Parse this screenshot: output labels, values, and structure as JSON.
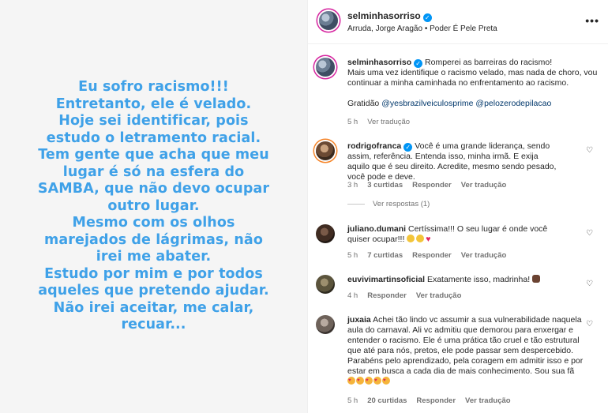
{
  "story": {
    "lines": [
      "Eu sofro racismo!!!",
      "Entretanto, ele é  velado.",
      "Hoje sei identificar, pois",
      "estudo o letramento  racial.",
      "Tem gente que acha que meu",
      "lugar é só  na esfera  do",
      "SAMBA,  que não  devo ocupar",
      "outro lugar.",
      "Mesmo com os olhos",
      "marejados de lágrimas, não",
      "irei me abater.",
      "Estudo por mim e por todos",
      "aqueles que pretendo ajudar.",
      "Não  irei aceitar, me calar,",
      "recuar..."
    ],
    "text_color": "#3fa1e8"
  },
  "header": {
    "username": "selminhasorriso",
    "subtitle": "Arruda, Jorge Aragão • Poder É Pele Preta",
    "more_icon": "•••"
  },
  "caption": {
    "username": "selminhasorriso",
    "line1": "Romperei as barreiras do racismo!",
    "line2": "Mais uma vez identifique o racismo velado, mas nada de choro, vou",
    "line3": "continuar a minha caminhada no enfrentamento ao racismo.",
    "gratidao": "Gratidão",
    "mention1": "@yesbrazilveiculosprime",
    "mention2": "@pelozerodepilacao",
    "time": "5 h",
    "translate": "Ver tradução"
  },
  "comments": [
    {
      "username": "rodrigofranca",
      "text": "Você é uma grande liderança, sendo assim, referência. Entenda isso, minha irmã. E exija aquilo que é seu direito. Acredite, mesmo sendo pesado, você pode e deve.",
      "time": "3 h",
      "likes": "3 curtidas",
      "reply": "Responder",
      "translate": "Ver tradução",
      "view_replies": "Ver respostas (1)"
    },
    {
      "username": "juliano.dumani",
      "text": "Certíssima!!! O seu lugar é onde você quiser ocupar!!!",
      "time": "5 h",
      "likes": "7 curtidas",
      "reply": "Responder",
      "translate": "Ver tradução"
    },
    {
      "username": "euvivimartinsoficial",
      "text": "Exatamente isso, madrinha!",
      "time": "4 h",
      "reply": "Responder",
      "translate": "Ver tradução"
    },
    {
      "username": "juxaia",
      "text": "Achei tão lindo vc assumir a sua vulnerabilidade naquela aula do carnaval. Ali vc admitiu que demorou para enxergar e entender o racismo. Ele é uma prática tão cruel e tão estrutural que até para nós, pretos, ele pode passar sem despercebido. Parabéns pelo aprendizado, pela coragem em admitir isso e por estar em busca a cada dia de mais conhecimento. Sou sua fã",
      "time": "5 h",
      "likes": "20 curtidas",
      "reply": "Responder",
      "translate": "Ver tradução"
    }
  ],
  "colors": {
    "verified": "#0095f6",
    "meta": "#737373",
    "link": "#00376b"
  },
  "icons": {
    "verified": "verified-badge-icon",
    "heart": "heart-outline-icon",
    "more": "more-horizontal-icon"
  }
}
